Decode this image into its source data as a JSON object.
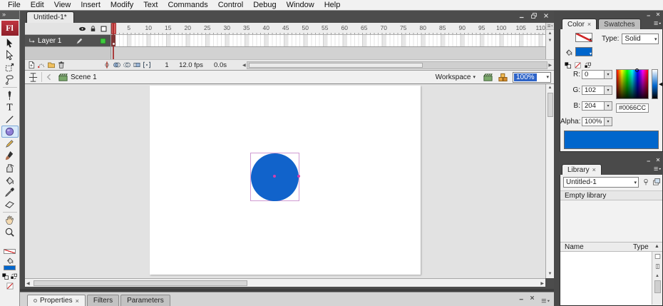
{
  "menu_bar": {
    "items": [
      "File",
      "Edit",
      "View",
      "Insert",
      "Modify",
      "Text",
      "Commands",
      "Control",
      "Debug",
      "Window",
      "Help"
    ]
  },
  "toolbar": {
    "collapse_glyph": "»",
    "logo_text": "Fl",
    "tools": [
      {
        "name": "selection-tool",
        "icon": "selection"
      },
      {
        "name": "subselection-tool",
        "icon": "subselection"
      },
      {
        "name": "free-transform-tool",
        "icon": "transform"
      },
      {
        "name": "lasso-tool",
        "icon": "lasso"
      },
      {
        "divider": true
      },
      {
        "name": "pen-tool",
        "icon": "pen"
      },
      {
        "name": "text-tool",
        "icon": "text"
      },
      {
        "name": "line-tool",
        "icon": "line"
      },
      {
        "name": "oval-tool",
        "icon": "oval",
        "selected": true
      },
      {
        "name": "pencil-tool",
        "icon": "pencil"
      },
      {
        "name": "brush-tool",
        "icon": "brush"
      },
      {
        "name": "ink-bottle-tool",
        "icon": "inkbottle"
      },
      {
        "name": "paint-bucket-tool",
        "icon": "bucket"
      },
      {
        "name": "eyedropper-tool",
        "icon": "eyedropper"
      },
      {
        "name": "eraser-tool",
        "icon": "eraser"
      },
      {
        "divider": true
      },
      {
        "name": "hand-tool",
        "icon": "hand"
      },
      {
        "name": "zoom-tool",
        "icon": "magnifier"
      }
    ],
    "stroke_color": "none",
    "fill_color": "#0066CC"
  },
  "document": {
    "tab_title": "Untitled-1*"
  },
  "timeline": {
    "layer_name": "Layer 1",
    "ruler_numbers": [
      5,
      10,
      15,
      20,
      25,
      30,
      35,
      40,
      45,
      50,
      55,
      60,
      65,
      70,
      75,
      80,
      85,
      90,
      95,
      100,
      105,
      110
    ],
    "current_frame": "1",
    "frame_rate": "12.0 fps",
    "elapsed_time": "0.0s"
  },
  "edit_bar": {
    "scene_name": "Scene 1",
    "workspace_label": "Workspace",
    "zoom_value": "100%"
  },
  "stage": {
    "shape": "circle",
    "fill": "#1163CB",
    "selection_outline": "#cf9bd2",
    "handle_color": "#d23fae"
  },
  "color_panel": {
    "tab_active": "Color",
    "tab_inactive": "Swatches",
    "type_label": "Type:",
    "type_value": "Solid",
    "channels": [
      {
        "label": "R:",
        "value": "0"
      },
      {
        "label": "G:",
        "value": "102"
      },
      {
        "label": "B:",
        "value": "204"
      },
      {
        "label": "Alpha:",
        "value": "100%"
      }
    ],
    "hex_value": "#0066CC",
    "preview_color": "#0066CC"
  },
  "library_panel": {
    "tab": "Library",
    "document_name": "Untitled-1",
    "empty_text": "Empty library",
    "columns": [
      "Name",
      "Type"
    ]
  },
  "properties_panel": {
    "tabs": [
      "Properties",
      "Filters",
      "Parameters"
    ]
  },
  "glyphs": {
    "dropdown": "▾",
    "up": "▲",
    "down": "▼",
    "left": "◀",
    "right": "▶",
    "minimize": "–",
    "close": "×",
    "collapse": "»",
    "slider_arrow": "◀"
  }
}
